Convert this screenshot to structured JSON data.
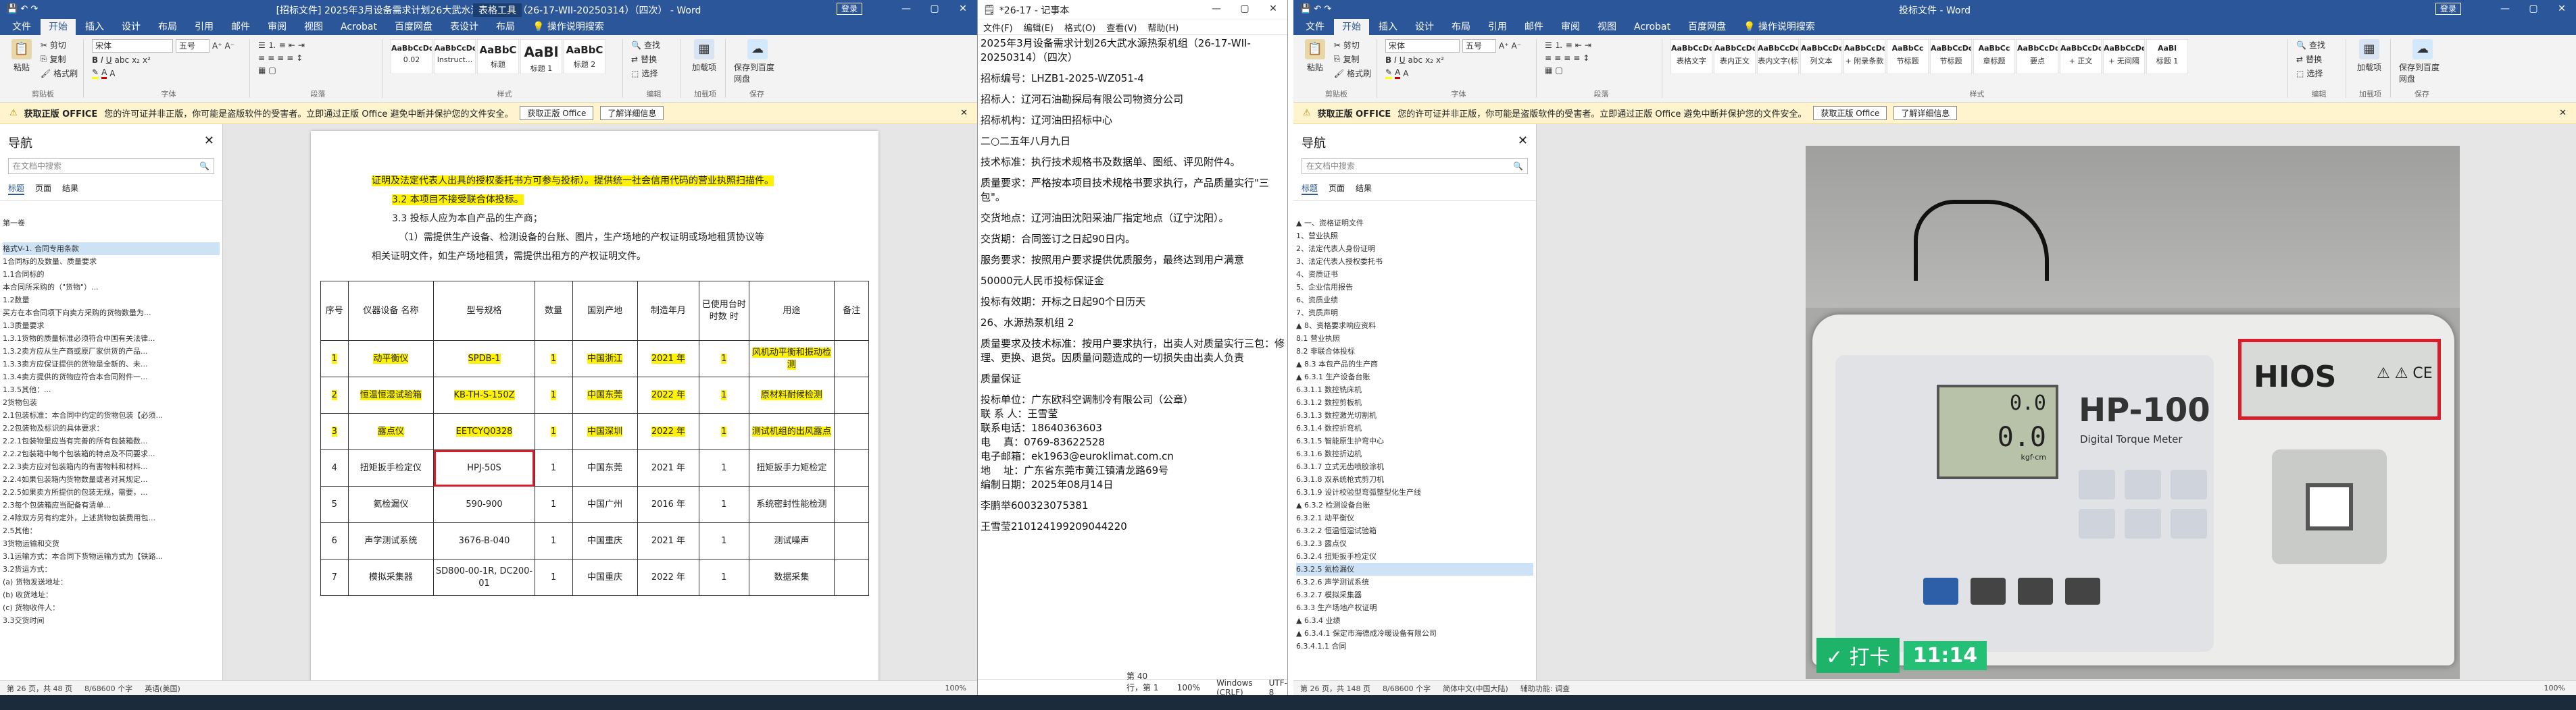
{
  "left_window": {
    "title": "[招标文件] 2025年3月设备需求计划26大武水源热泵机组（26-17-WII-20250314）（四次） - Word",
    "context_tab": "表格工具",
    "sign_in": "登录",
    "tabs": [
      "文件",
      "开始",
      "插入",
      "设计",
      "布局",
      "引用",
      "邮件",
      "审阅",
      "视图",
      "Acrobat",
      "百度网盘",
      "表设计",
      "布局"
    ],
    "active_tab": "开始",
    "search_tell": "操作说明搜索",
    "ribbon": {
      "paste": "粘贴",
      "cut": "剪切",
      "copy": "复制",
      "format_painter": "格式刷",
      "font_name": "宋体",
      "font_size": "五号",
      "styles": [
        {
          "preview": "AaBbCcDd",
          "name": "0.02"
        },
        {
          "preview": "AaBbCcDd",
          "name": "Instruct..."
        },
        {
          "preview": "AaBbC",
          "name": "标题"
        },
        {
          "preview": "AaBl",
          "name": "标题 1"
        },
        {
          "preview": "AaBbC",
          "name": "标题 2"
        }
      ],
      "find": "查找",
      "replace": "替换",
      "select": "选择",
      "addin": "加载项",
      "baidu_save": "保存到百度网盘",
      "groups": [
        "剪贴板",
        "字体",
        "段落",
        "样式",
        "编辑",
        "加载项",
        "保存"
      ]
    },
    "notice": {
      "label": "获取正版 OFFICE",
      "text": "您的许可证并非正版，你可能是盗版软件的受害者。立即通过正版 Office 避免中断并保护您的文件安全。",
      "button1": "获取正版 Office",
      "button2": "了解详细信息"
    },
    "nav": {
      "title": "导航",
      "search_placeholder": "在文档中搜索",
      "tabs": [
        "标题",
        "页面",
        "结果"
      ],
      "items": [
        "",
        "第一卷",
        "",
        "格式V-1. 合同专用条款",
        "1合同标的及数量、质量要求",
        "  1.1合同标的",
        "    本合同所采购的（\"货物\"）...",
        "  1.2数量",
        "    买方在本合同项下向卖方采购的货物数量为...",
        "  1.3质量要求",
        "    1.3.1货物的质量标准必须符合中国有关法律...",
        "    1.3.2卖方应从生产商或原厂家供货的产品...",
        "    1.3.3卖方应保证提供的货物是全新的、未...",
        "    1.3.4卖方提供的货物应符合本合同附件一...",
        "    1.3.5其他：...",
        "2货物包装",
        "  2.1包装标准：本合同中约定的货物包装【必须...",
        "  2.2包装物及标识的具体要求：",
        "    2.2.1包装物里应当有完善的所有包装箱数...",
        "    2.2.2包装箱中每个包装箱的特点及不同要求...",
        "    2.2.3卖方应对包装箱内的有害物料和材料...",
        "    2.2.4如果包装箱内货物数量或者对其规定...",
        "    2.2.5如果卖方所提供的包装无规，需要，...",
        "  2.3每个包装箱应当配备有清单...",
        "  2.4除双方另有约定外，上述货物包装费用包...",
        "  2.5其他：",
        "3货物运输和交货",
        "  3.1运输方式：本合同下货物运输方式为【铁路...",
        "  3.2货运方式：",
        "    (a) 货物发送地址：",
        "    (b) 收货地址：",
        "    (c) 货物收件人：",
        "  3.3交货时间"
      ]
    },
    "doc": {
      "line1": "证明及法定代表人出具的授权委托书方可参与投标）。提供统一社会信用代码的营业执照扫描件。",
      "line2": "3.2 本项目不接受联合体投标。",
      "line3": "3.3 投标人应为本自产品的生产商；",
      "line4": "（1）需提供生产设备、检测设备的台账、图片，生产场地的产权证明或场地租赁协议等",
      "line5": "相关证明文件，如生产场地租赁，需提供出租方的产权证明文件。",
      "table_headers": [
        "序号",
        "仪器设备 名称",
        "型号规格",
        "数量",
        "国别产地",
        "制造年月",
        "已使用台时时数 时",
        "用途",
        "备注"
      ],
      "table_rows": [
        [
          "1",
          "动平衡仪",
          "SPDB-1",
          "1",
          "中国浙江",
          "2021 年",
          "1",
          "风机动平衡和振动检测",
          ""
        ],
        [
          "2",
          "恒温恒湿试验箱",
          "KB-TH-S-150Z",
          "1",
          "中国东莞",
          "2022 年",
          "1",
          "原材料耐候检测",
          ""
        ],
        [
          "3",
          "露点仪",
          "EETCYQ0328",
          "1",
          "中国深圳",
          "2022 年",
          "1",
          "测试机组的出风露点",
          ""
        ],
        [
          "4",
          "扭矩扳手检定仪",
          "HPJ-50S",
          "1",
          "中国东莞",
          "2021 年",
          "1",
          "扭矩扳手力矩检定",
          ""
        ],
        [
          "5",
          "氦检漏仪",
          "590-900",
          "1",
          "中国广州",
          "2016 年",
          "1",
          "系统密封性能检测",
          ""
        ],
        [
          "6",
          "声学测试系统",
          "3676-B-040",
          "1",
          "中国重庆",
          "2021 年",
          "1",
          "测试噪声",
          ""
        ],
        [
          "7",
          "模拟采集器",
          "SD800-00-1R, DC200-01",
          "1",
          "中国重庆",
          "2022 年",
          "1",
          "数据采集",
          ""
        ]
      ]
    },
    "status": {
      "page": "第 26 页，共 48 页",
      "words": "8/68600 个字",
      "lang": "英语(美国)",
      "zoom": "100%"
    }
  },
  "notepad": {
    "title": "*26-17 - 记事本",
    "menu": [
      "文件(F)",
      "编辑(E)",
      "格式(O)",
      "查看(V)",
      "帮助(H)"
    ],
    "lines": [
      "2025年3月设备需求计划26大武水源热泵机组（26-17-WII-20250314）（四次）",
      "",
      "招标编号：LHZB1-2025-WZ051-4",
      "",
      "招标人：辽河石油勘探局有限公司物资分公司",
      "",
      "招标机构：辽河油田招标中心",
      "",
      "二○二五年八月九日",
      "",
      "技术标准：执行技术规格书及数据单、图纸、评见附件4。",
      "",
      "质量要求：严格按本项目技术规格书要求执行，产品质量实行\"三包\"。",
      "",
      "交货地点：辽河油田沈阳采油厂指定地点（辽宁沈阳）。",
      "",
      "交货期：合同签订之日起90日内。",
      "",
      "服务要求：按照用户要求提供优质服务，最终达到用户满意",
      "",
      "50000元人民币投标保证金",
      "",
      "投标有效期：开标之日起90个日历天",
      "",
      "26、水源热泵机组 2",
      "",
      "质量要求及技术标准：按用户要求执行，出卖人对质量实行三包：修理、更换、退货。因质量问题造成的一切损失由出卖人负责",
      "",
      "质量保证",
      "",
      "投标单位：广东欧科空调制冷有限公司（公章）",
      "联 系 人：王雪莹",
      "联系电话：18640363603",
      "电    真：0769-83622528",
      "电子邮箱：ek1963@euroklimat.com.cn",
      "地    址：广东省东莞市黄江镇清龙路69号",
      "编制日期：2025年08月14日",
      "",
      "李鹏举600323075381",
      "",
      "王雪莹210124199209044220"
    ],
    "status": {
      "position": "第 40 行，第 1 列",
      "zoom": "100%",
      "eol": "Windows (CRLF)",
      "encoding": "UTF-8"
    }
  },
  "right_window": {
    "title": "投标文件 - Word",
    "sign_in": "登录",
    "tabs": [
      "文件",
      "开始",
      "插入",
      "设计",
      "布局",
      "引用",
      "邮件",
      "审阅",
      "视图",
      "Acrobat",
      "百度网盘"
    ],
    "active_tab": "开始",
    "search_tell": "操作说明搜索",
    "ribbon": {
      "paste": "粘贴",
      "cut": "剪切",
      "copy": "复制",
      "format_painter": "格式刷",
      "font_name": "宋体",
      "font_size": "五号",
      "styles": [
        {
          "preview": "AaBbCcDc",
          "name": "表格文字"
        },
        {
          "preview": "AaBbCcDc",
          "name": "表内正文"
        },
        {
          "preview": "AaBbCcDc",
          "name": "表内文字(标"
        },
        {
          "preview": "AaBbCcDc",
          "name": "列文本"
        },
        {
          "preview": "AaBbCcDc",
          "name": "+ 附录条款"
        },
        {
          "preview": "AaBbCc",
          "name": "节标题"
        },
        {
          "preview": "AaBbCcDc",
          "name": "节标题"
        },
        {
          "preview": "AaBbCc",
          "name": "章标题"
        },
        {
          "preview": "AaBbCcDd",
          "name": "要点"
        },
        {
          "preview": "AaBbCcDd",
          "name": "+ 正文"
        },
        {
          "preview": "AaBbCcDd",
          "name": "+ 无间隔"
        },
        {
          "preview": "AaBl",
          "name": "标题 1"
        }
      ],
      "find": "查找",
      "replace": "替换",
      "select": "选择",
      "addin": "加载项",
      "baidu_save": "保存到百度网盘",
      "groups": [
        "剪贴板",
        "字体",
        "段落",
        "样式",
        "编辑",
        "加载项",
        "保存"
      ]
    },
    "notice": {
      "label": "获取正版 OFFICE",
      "text": "您的许可证并非正版，你可能是盗版软件的受害者。立即通过正版 Office 避免中断并保护您的文件安全。",
      "button1": "获取正版 Office",
      "button2": "了解详细信息"
    },
    "nav": {
      "title": "导航",
      "search_placeholder": "在文档中搜索",
      "tabs": [
        "标题",
        "页面",
        "结果"
      ],
      "items": [
        "",
        "▲ 一、资格证明文件",
        "    1、营业执照",
        "    2、法定代表人身份证明",
        "    3、法定代表人授权委托书",
        "    4、资质证书",
        "    5、企业信用报告",
        "    6、资质业绩",
        "    7、资质声明",
        "  ▲ 8、资格要求响应资料",
        "    8.1 营业执照",
        "    8.2 非联合体投标",
        "    ▲ 8.3 本包产品的生产商",
        "      ▲ 6.3.1 生产设备台账",
        "        6.3.1.1 数控铣床机",
        "        6.3.1.2 数控剪板机",
        "        6.3.1.3 数控激光切割机",
        "        6.3.1.4 数控折弯机",
        "        6.3.1.5 智能原生护弯中心",
        "        6.3.1.6 数控折边机",
        "        6.3.1.7 立式无齿喷胶涂机",
        "        6.3.1.8 双系统枪式剪刀机",
        "        6.3.1.9 设计校验型弯弧整型化生产线",
        "      ▲ 6.3.2 检测设备台账",
        "        6.3.2.1 动平衡仪",
        "        6.3.2.2 恒温恒湿试验箱",
        "        6.3.2.3 露点仪",
        "        6.3.2.4 扭矩扳手检定仪",
        "        6.3.2.5 氦检漏仪",
        "        6.3.2.6 声学测试系统",
        "        6.3.2.7 模拟采集器",
        "    6.3.3 生产场地产权证明",
        "    ▲ 6.3.4 业绩",
        "      ▲ 6.3.4.1 保定市海德成冷暖设备有限公司",
        "        6.3.4.1.1 合同"
      ],
      "highlight_index": 28
    },
    "photo": {
      "brand": "HIOS",
      "model": "HP-100",
      "subtitle": "Digital Torque Meter",
      "reading1": "0.0",
      "reading2": "0.0",
      "unit": "kgf·cm",
      "stamp_label": "✓ 打卡",
      "stamp_time": "11:14"
    },
    "status": {
      "page": "第 26 页，共 148 页",
      "words": "8/68600 个字",
      "lang": "简体中文(中国大陆)",
      "a11y": "辅助功能: 调查",
      "zoom": "100%"
    }
  }
}
